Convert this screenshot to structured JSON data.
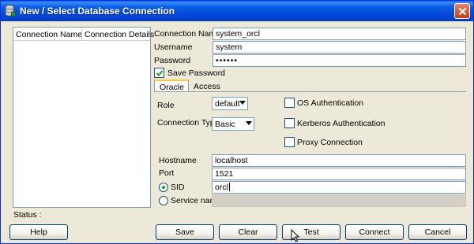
{
  "window": {
    "title": "New / Select Database Connection"
  },
  "list": {
    "columns": [
      "Connection Name",
      "Connection Details"
    ]
  },
  "status": {
    "label": "Status :"
  },
  "connection": {
    "name_label": "Connection Name",
    "name_value": "system_orcl",
    "username_label": "Username",
    "username_value": "system",
    "password_label": "Password",
    "password_value": "••••••",
    "save_password_label": "Save Password",
    "save_password_checked": true
  },
  "tabs": [
    {
      "label": "Oracle",
      "active": true
    },
    {
      "label": "Access",
      "active": false
    }
  ],
  "oracle": {
    "role_label": "Role",
    "role_value": "default",
    "conn_type_label": "Connection Type",
    "conn_type_value": "Basic",
    "os_auth_label": "OS Authentication",
    "kerberos_label": "Kerberos Authentication",
    "proxy_label": "Proxy Connection",
    "hostname_label": "Hostname",
    "hostname_value": "localhost",
    "port_label": "Port",
    "port_value": "1521",
    "sid_label": "SID",
    "sid_value": "orcl",
    "service_label": "Service name",
    "service_value": ""
  },
  "buttons": {
    "help": "Help",
    "save": "Save",
    "clear": "Clear",
    "test": "Test",
    "connect": "Connect",
    "cancel": "Cancel"
  },
  "colors": {
    "titlebar": "#0054e3",
    "face": "#ece9d8",
    "radio_dot": "#21a121",
    "tab_highlight": "#ffc83c"
  }
}
